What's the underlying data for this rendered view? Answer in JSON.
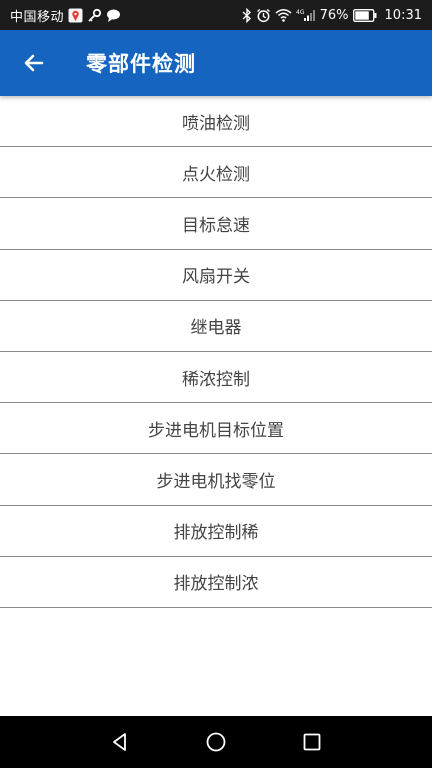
{
  "status_bar": {
    "carrier": "中国移动",
    "battery_percent": "76%",
    "time": "10:31",
    "icons_left": [
      "maps-notification-icon",
      "key-icon",
      "chat-bubble-icon"
    ],
    "icons_right": [
      "bluetooth-icon",
      "alarm-icon",
      "wifi-icon",
      "signal-icon",
      "battery-icon"
    ]
  },
  "app_bar": {
    "title": "零部件检测",
    "background": "#1565c0"
  },
  "list": {
    "items": [
      {
        "label": "喷油检测"
      },
      {
        "label": "点火检测"
      },
      {
        "label": "目标怠速"
      },
      {
        "label": "风扇开关"
      },
      {
        "label": "继电器"
      },
      {
        "label": "稀浓控制"
      },
      {
        "label": "步进电机目标位置"
      },
      {
        "label": "步进电机找零位"
      },
      {
        "label": "排放控制稀"
      },
      {
        "label": "排放控制浓"
      }
    ]
  },
  "nav_bar": {
    "buttons": [
      "back-triangle-icon",
      "home-circle-icon",
      "recents-square-icon"
    ]
  }
}
